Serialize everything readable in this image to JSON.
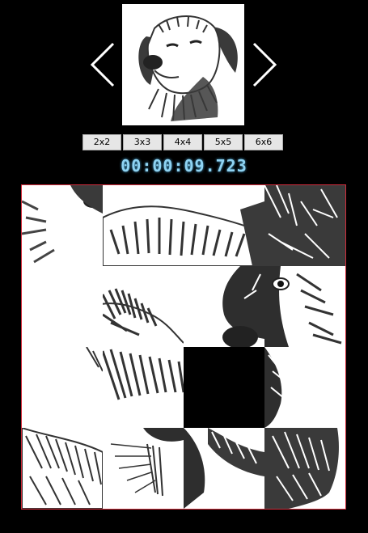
{
  "window": {
    "background": "#000000"
  },
  "preview": {
    "image_icon": "dog-sketch-icon"
  },
  "navigation": {
    "prev_icon": "chevron-left-icon",
    "next_icon": "chevron-right-icon"
  },
  "size_options": [
    "2x2",
    "3x3",
    "4x4",
    "5x5",
    "6x6"
  ],
  "timer": {
    "value": "00:00:09.723",
    "color": "#8fd3f2"
  },
  "board": {
    "grid": "4x4",
    "border_color": "#d22b3a",
    "tile_order": [
      1,
      2,
      4,
      3,
      5,
      6,
      7,
      8,
      9,
      10,
      0,
      12,
      13,
      14,
      15,
      16
    ],
    "empty_tile": 11
  }
}
